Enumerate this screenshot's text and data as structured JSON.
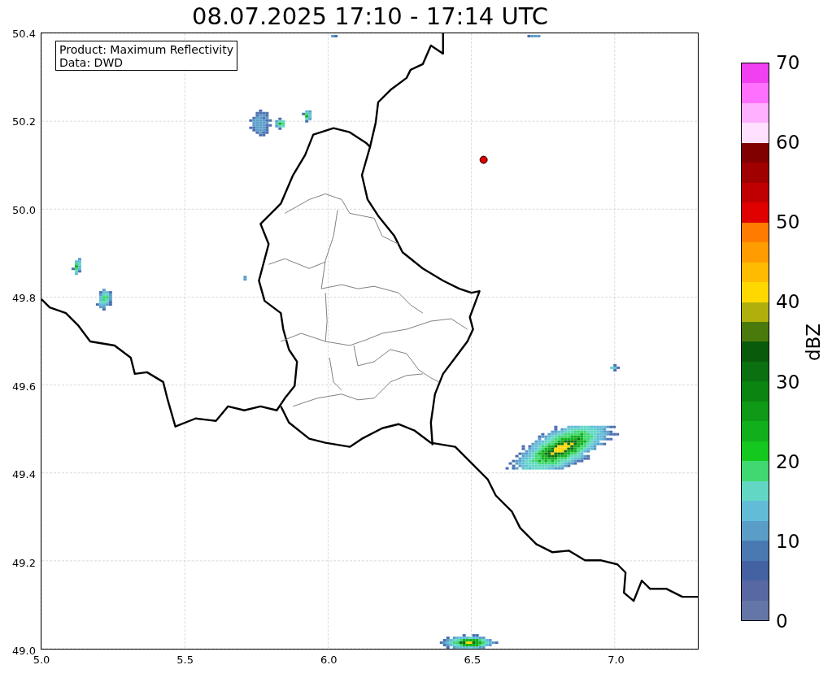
{
  "title": "08.07.2025 17:10 - 17:14 UTC",
  "map": {
    "annotation": [
      "Product: Maximum Reflectivity",
      "Data: DWD"
    ],
    "xticks": [
      "5.0",
      "5.5",
      "6.0",
      "6.5",
      "7.0"
    ],
    "yticks": [
      "50.4",
      "50.2",
      "50.0",
      "49.8",
      "49.6",
      "49.4",
      "49.2",
      "49.0"
    ]
  },
  "colorbar": {
    "label": "dBZ",
    "ticks": [
      "70",
      "60",
      "50",
      "40",
      "30",
      "20",
      "10",
      "0"
    ],
    "bands": [
      {
        "color": "#6476a8"
      },
      {
        "color": "#5868a2"
      },
      {
        "color": "#4462a2"
      },
      {
        "color": "#4a79b2"
      },
      {
        "color": "#5a9ec8"
      },
      {
        "color": "#62bcd8"
      },
      {
        "color": "#62d8c4"
      },
      {
        "color": "#40d870"
      },
      {
        "color": "#14c820"
      },
      {
        "color": "#10b01c"
      },
      {
        "color": "#0e9a16"
      },
      {
        "color": "#0c8412"
      },
      {
        "color": "#0a7010"
      },
      {
        "color": "#0a5a0c"
      },
      {
        "color": "#4a7a0c"
      },
      {
        "color": "#b0b00c"
      },
      {
        "color": "#ffd800"
      },
      {
        "color": "#ffbc00"
      },
      {
        "color": "#ff9c00"
      },
      {
        "color": "#ff7c00"
      },
      {
        "color": "#e00000"
      },
      {
        "color": "#c00000"
      },
      {
        "color": "#a00000"
      },
      {
        "color": "#800000"
      },
      {
        "color": "#ffe0ff"
      },
      {
        "color": "#ffb0ff"
      },
      {
        "color": "#ff70ff"
      },
      {
        "color": "#f040f0"
      }
    ]
  }
}
